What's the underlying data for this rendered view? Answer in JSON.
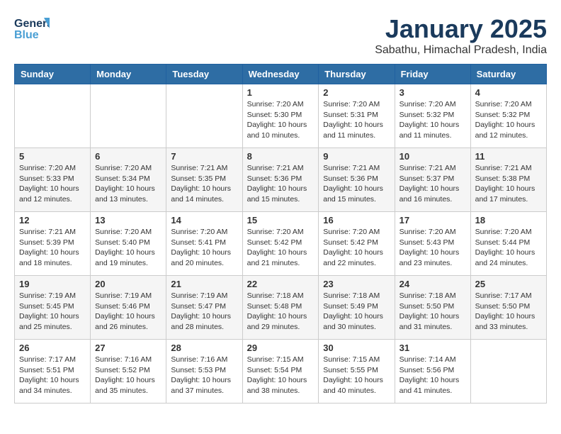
{
  "header": {
    "logo_general": "General",
    "logo_blue": "Blue",
    "month_title": "January 2025",
    "subtitle": "Sabathu, Himachal Pradesh, India"
  },
  "days_of_week": [
    "Sunday",
    "Monday",
    "Tuesday",
    "Wednesday",
    "Thursday",
    "Friday",
    "Saturday"
  ],
  "weeks": [
    [
      {
        "day": "",
        "info": ""
      },
      {
        "day": "",
        "info": ""
      },
      {
        "day": "",
        "info": ""
      },
      {
        "day": "1",
        "info": "Sunrise: 7:20 AM\nSunset: 5:30 PM\nDaylight: 10 hours\nand 10 minutes."
      },
      {
        "day": "2",
        "info": "Sunrise: 7:20 AM\nSunset: 5:31 PM\nDaylight: 10 hours\nand 11 minutes."
      },
      {
        "day": "3",
        "info": "Sunrise: 7:20 AM\nSunset: 5:32 PM\nDaylight: 10 hours\nand 11 minutes."
      },
      {
        "day": "4",
        "info": "Sunrise: 7:20 AM\nSunset: 5:32 PM\nDaylight: 10 hours\nand 12 minutes."
      }
    ],
    [
      {
        "day": "5",
        "info": "Sunrise: 7:20 AM\nSunset: 5:33 PM\nDaylight: 10 hours\nand 12 minutes."
      },
      {
        "day": "6",
        "info": "Sunrise: 7:20 AM\nSunset: 5:34 PM\nDaylight: 10 hours\nand 13 minutes."
      },
      {
        "day": "7",
        "info": "Sunrise: 7:21 AM\nSunset: 5:35 PM\nDaylight: 10 hours\nand 14 minutes."
      },
      {
        "day": "8",
        "info": "Sunrise: 7:21 AM\nSunset: 5:36 PM\nDaylight: 10 hours\nand 15 minutes."
      },
      {
        "day": "9",
        "info": "Sunrise: 7:21 AM\nSunset: 5:36 PM\nDaylight: 10 hours\nand 15 minutes."
      },
      {
        "day": "10",
        "info": "Sunrise: 7:21 AM\nSunset: 5:37 PM\nDaylight: 10 hours\nand 16 minutes."
      },
      {
        "day": "11",
        "info": "Sunrise: 7:21 AM\nSunset: 5:38 PM\nDaylight: 10 hours\nand 17 minutes."
      }
    ],
    [
      {
        "day": "12",
        "info": "Sunrise: 7:21 AM\nSunset: 5:39 PM\nDaylight: 10 hours\nand 18 minutes."
      },
      {
        "day": "13",
        "info": "Sunrise: 7:20 AM\nSunset: 5:40 PM\nDaylight: 10 hours\nand 19 minutes."
      },
      {
        "day": "14",
        "info": "Sunrise: 7:20 AM\nSunset: 5:41 PM\nDaylight: 10 hours\nand 20 minutes."
      },
      {
        "day": "15",
        "info": "Sunrise: 7:20 AM\nSunset: 5:42 PM\nDaylight: 10 hours\nand 21 minutes."
      },
      {
        "day": "16",
        "info": "Sunrise: 7:20 AM\nSunset: 5:42 PM\nDaylight: 10 hours\nand 22 minutes."
      },
      {
        "day": "17",
        "info": "Sunrise: 7:20 AM\nSunset: 5:43 PM\nDaylight: 10 hours\nand 23 minutes."
      },
      {
        "day": "18",
        "info": "Sunrise: 7:20 AM\nSunset: 5:44 PM\nDaylight: 10 hours\nand 24 minutes."
      }
    ],
    [
      {
        "day": "19",
        "info": "Sunrise: 7:19 AM\nSunset: 5:45 PM\nDaylight: 10 hours\nand 25 minutes."
      },
      {
        "day": "20",
        "info": "Sunrise: 7:19 AM\nSunset: 5:46 PM\nDaylight: 10 hours\nand 26 minutes."
      },
      {
        "day": "21",
        "info": "Sunrise: 7:19 AM\nSunset: 5:47 PM\nDaylight: 10 hours\nand 28 minutes."
      },
      {
        "day": "22",
        "info": "Sunrise: 7:18 AM\nSunset: 5:48 PM\nDaylight: 10 hours\nand 29 minutes."
      },
      {
        "day": "23",
        "info": "Sunrise: 7:18 AM\nSunset: 5:49 PM\nDaylight: 10 hours\nand 30 minutes."
      },
      {
        "day": "24",
        "info": "Sunrise: 7:18 AM\nSunset: 5:50 PM\nDaylight: 10 hours\nand 31 minutes."
      },
      {
        "day": "25",
        "info": "Sunrise: 7:17 AM\nSunset: 5:50 PM\nDaylight: 10 hours\nand 33 minutes."
      }
    ],
    [
      {
        "day": "26",
        "info": "Sunrise: 7:17 AM\nSunset: 5:51 PM\nDaylight: 10 hours\nand 34 minutes."
      },
      {
        "day": "27",
        "info": "Sunrise: 7:16 AM\nSunset: 5:52 PM\nDaylight: 10 hours\nand 35 minutes."
      },
      {
        "day": "28",
        "info": "Sunrise: 7:16 AM\nSunset: 5:53 PM\nDaylight: 10 hours\nand 37 minutes."
      },
      {
        "day": "29",
        "info": "Sunrise: 7:15 AM\nSunset: 5:54 PM\nDaylight: 10 hours\nand 38 minutes."
      },
      {
        "day": "30",
        "info": "Sunrise: 7:15 AM\nSunset: 5:55 PM\nDaylight: 10 hours\nand 40 minutes."
      },
      {
        "day": "31",
        "info": "Sunrise: 7:14 AM\nSunset: 5:56 PM\nDaylight: 10 hours\nand 41 minutes."
      },
      {
        "day": "",
        "info": ""
      }
    ]
  ]
}
